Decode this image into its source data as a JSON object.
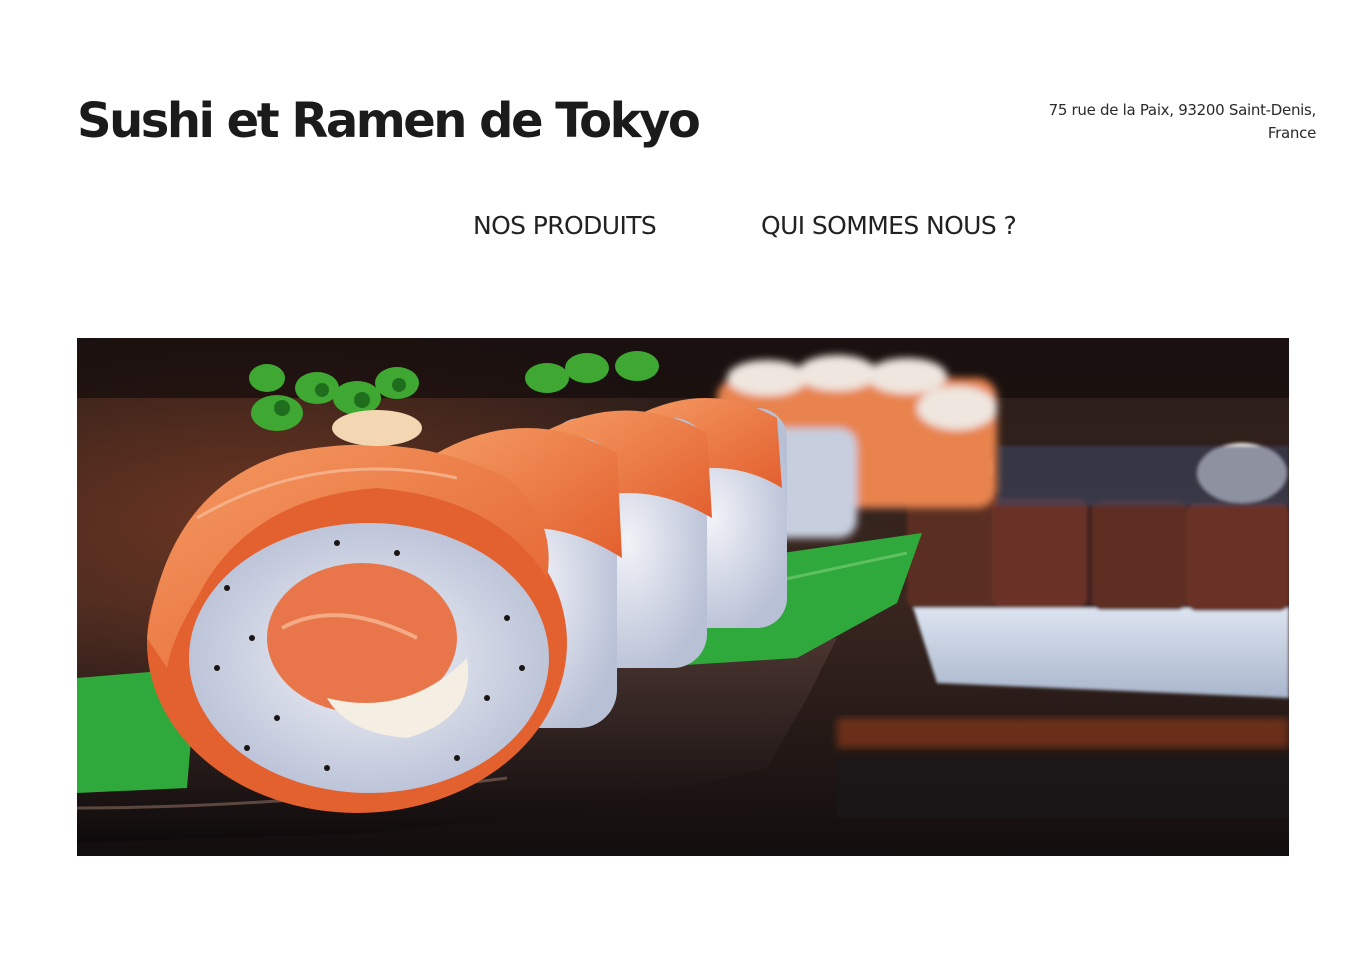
{
  "site": {
    "title": "Sushi et Ramen de Tokyo",
    "address_line1": "75 rue de la Paix, 93200 Saint-Denis,",
    "address_line2": "France"
  },
  "nav": {
    "items": [
      {
        "label": "NOS PRODUITS"
      },
      {
        "label": "QUI SOMMES NOUS ?"
      }
    ]
  },
  "hero": {
    "subject": "sushi rolls with salmon on a plate"
  },
  "colors": {
    "background": "#ffffff",
    "text": "#1b1b1b",
    "salmon": "#f07a48",
    "rice": "#dfe3ef",
    "leaf": "#2fa83c",
    "plate": "#141012"
  }
}
